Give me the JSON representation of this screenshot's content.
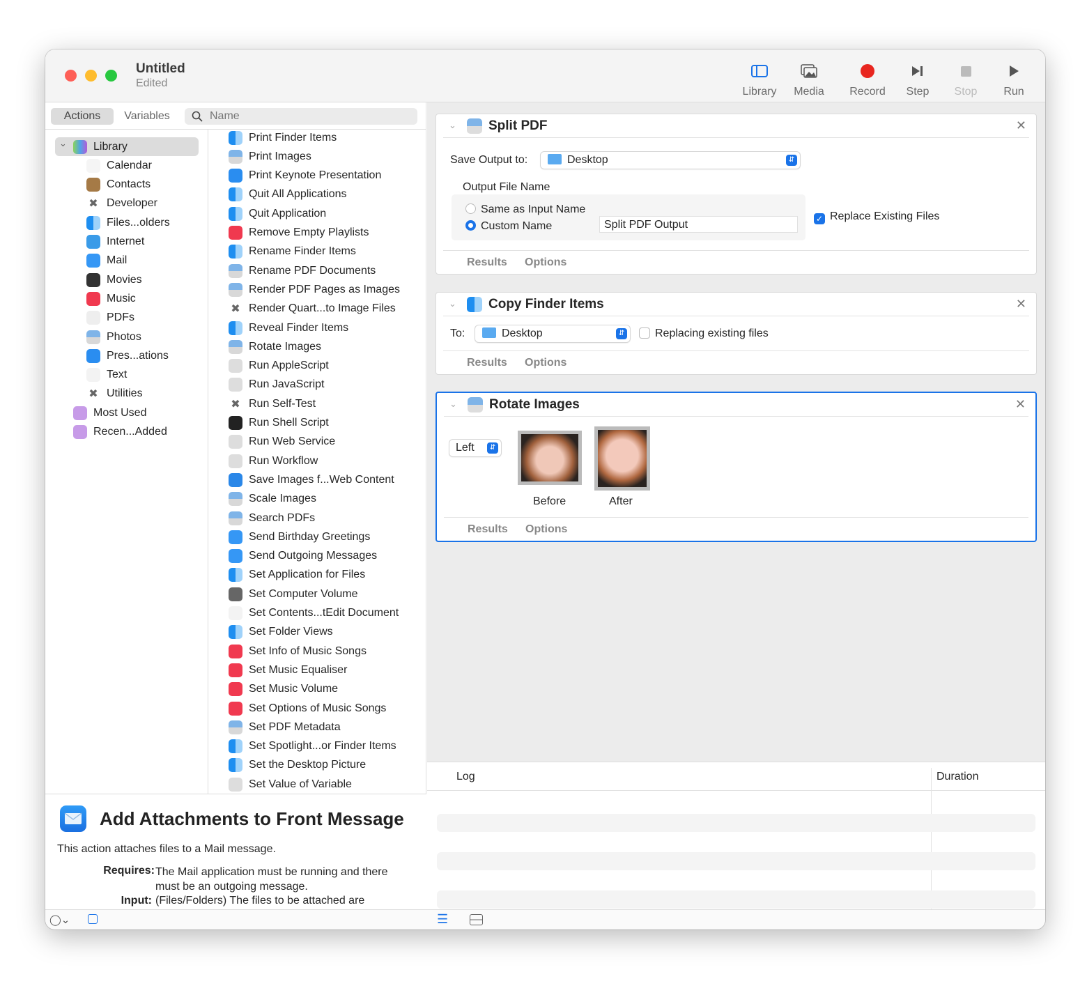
{
  "window": {
    "title": "Untitled",
    "subtitle": "Edited"
  },
  "toolbar": [
    {
      "label": "Library",
      "icon": "sidebar-icon"
    },
    {
      "label": "Media",
      "icon": "photos-icon"
    },
    {
      "label": "Record",
      "icon": "record-icon",
      "color": "#e8261f"
    },
    {
      "label": "Step",
      "icon": "step-icon"
    },
    {
      "label": "Stop",
      "icon": "stop-icon",
      "disabled": true
    },
    {
      "label": "Run",
      "icon": "play-icon"
    }
  ],
  "left_tabs": {
    "actions": "Actions",
    "variables": "Variables"
  },
  "search": {
    "placeholder": "Name"
  },
  "categories": [
    {
      "label": "Library",
      "icon": "library",
      "expanded": true
    },
    {
      "label": "Calendar",
      "icon": "calendar"
    },
    {
      "label": "Contacts",
      "icon": "contacts"
    },
    {
      "label": "Developer",
      "icon": "tools"
    },
    {
      "label": "Files...olders",
      "icon": "finder"
    },
    {
      "label": "Internet",
      "icon": "globe"
    },
    {
      "label": "Mail",
      "icon": "mail"
    },
    {
      "label": "Movies",
      "icon": "movie"
    },
    {
      "label": "Music",
      "icon": "music"
    },
    {
      "label": "PDFs",
      "icon": "pdf"
    },
    {
      "label": "Photos",
      "icon": "image"
    },
    {
      "label": "Pres...ations",
      "icon": "keynote"
    },
    {
      "label": "Text",
      "icon": "text"
    },
    {
      "label": "Utilities",
      "icon": "tools"
    },
    {
      "label": "Most Used",
      "icon": "smartfolder"
    },
    {
      "label": "Recen...Added",
      "icon": "smartfolder"
    }
  ],
  "actions": [
    {
      "label": "Print Finder Items",
      "icon": "finder"
    },
    {
      "label": "Print Images",
      "icon": "image"
    },
    {
      "label": "Print Keynote Presentation",
      "icon": "keynote"
    },
    {
      "label": "Quit All Applications",
      "icon": "finder"
    },
    {
      "label": "Quit Application",
      "icon": "finder"
    },
    {
      "label": "Remove Empty Playlists",
      "icon": "music"
    },
    {
      "label": "Rename Finder Items",
      "icon": "finder"
    },
    {
      "label": "Rename PDF Documents",
      "icon": "image"
    },
    {
      "label": "Render PDF Pages as Images",
      "icon": "image"
    },
    {
      "label": "Render Quart...to Image Files",
      "icon": "tools"
    },
    {
      "label": "Reveal Finder Items",
      "icon": "finder"
    },
    {
      "label": "Rotate Images",
      "icon": "image"
    },
    {
      "label": "Run AppleScript",
      "icon": "script"
    },
    {
      "label": "Run JavaScript",
      "icon": "script"
    },
    {
      "label": "Run Self-Test",
      "icon": "tools"
    },
    {
      "label": "Run Shell Script",
      "icon": "terminal"
    },
    {
      "label": "Run Web Service",
      "icon": "script"
    },
    {
      "label": "Run Workflow",
      "icon": "script"
    },
    {
      "label": "Save Images f...Web Content",
      "icon": "safari"
    },
    {
      "label": "Scale Images",
      "icon": "image"
    },
    {
      "label": "Search PDFs",
      "icon": "image"
    },
    {
      "label": "Send Birthday Greetings",
      "icon": "mail"
    },
    {
      "label": "Send Outgoing Messages",
      "icon": "mail"
    },
    {
      "label": "Set Application for Files",
      "icon": "finder"
    },
    {
      "label": "Set Computer Volume",
      "icon": "volume"
    },
    {
      "label": "Set Contents...tEdit Document",
      "icon": "text"
    },
    {
      "label": "Set Folder Views",
      "icon": "finder"
    },
    {
      "label": "Set Info of Music Songs",
      "icon": "music"
    },
    {
      "label": "Set Music Equaliser",
      "icon": "music"
    },
    {
      "label": "Set Music Volume",
      "icon": "music"
    },
    {
      "label": "Set Options of Music Songs",
      "icon": "music"
    },
    {
      "label": "Set PDF Metadata",
      "icon": "image"
    },
    {
      "label": "Set Spotlight...or Finder Items",
      "icon": "finder"
    },
    {
      "label": "Set the Desktop Picture",
      "icon": "finder"
    },
    {
      "label": "Set Value of Variable",
      "icon": "script"
    }
  ],
  "description": {
    "title": "Add Attachments to Front Message",
    "summary": "This action attaches files to a Mail message.",
    "requires_label": "Requires:",
    "requires": "The Mail application must be running and there must be an outgoing message.",
    "input_label": "Input:",
    "input": "(Files/Folders) The files to be attached are"
  },
  "workflow": {
    "split_pdf": {
      "title": "Split PDF",
      "save_label": "Save Output to:",
      "save_value": "Desktop",
      "output_name_label": "Output File Name",
      "radio_same": "Same as Input Name",
      "radio_custom": "Custom Name",
      "custom_selected": true,
      "custom_value": "Split PDF Output",
      "replace_label": "Replace Existing Files",
      "replace_checked": true,
      "results": "Results",
      "options": "Options"
    },
    "copy_finder": {
      "title": "Copy Finder Items",
      "to_label": "To:",
      "to_value": "Desktop",
      "replacing_label": "Replacing existing files",
      "replacing_checked": false,
      "results": "Results",
      "options": "Options"
    },
    "rotate": {
      "title": "Rotate Images",
      "direction": "Left",
      "before": "Before",
      "after": "After",
      "results": "Results",
      "options": "Options"
    }
  },
  "log": {
    "col_log": "Log",
    "col_duration": "Duration"
  },
  "colors": {
    "accent": "#1a73e8",
    "close": "#fe5f57",
    "minimize": "#febc2e",
    "zoom": "#28c840"
  }
}
